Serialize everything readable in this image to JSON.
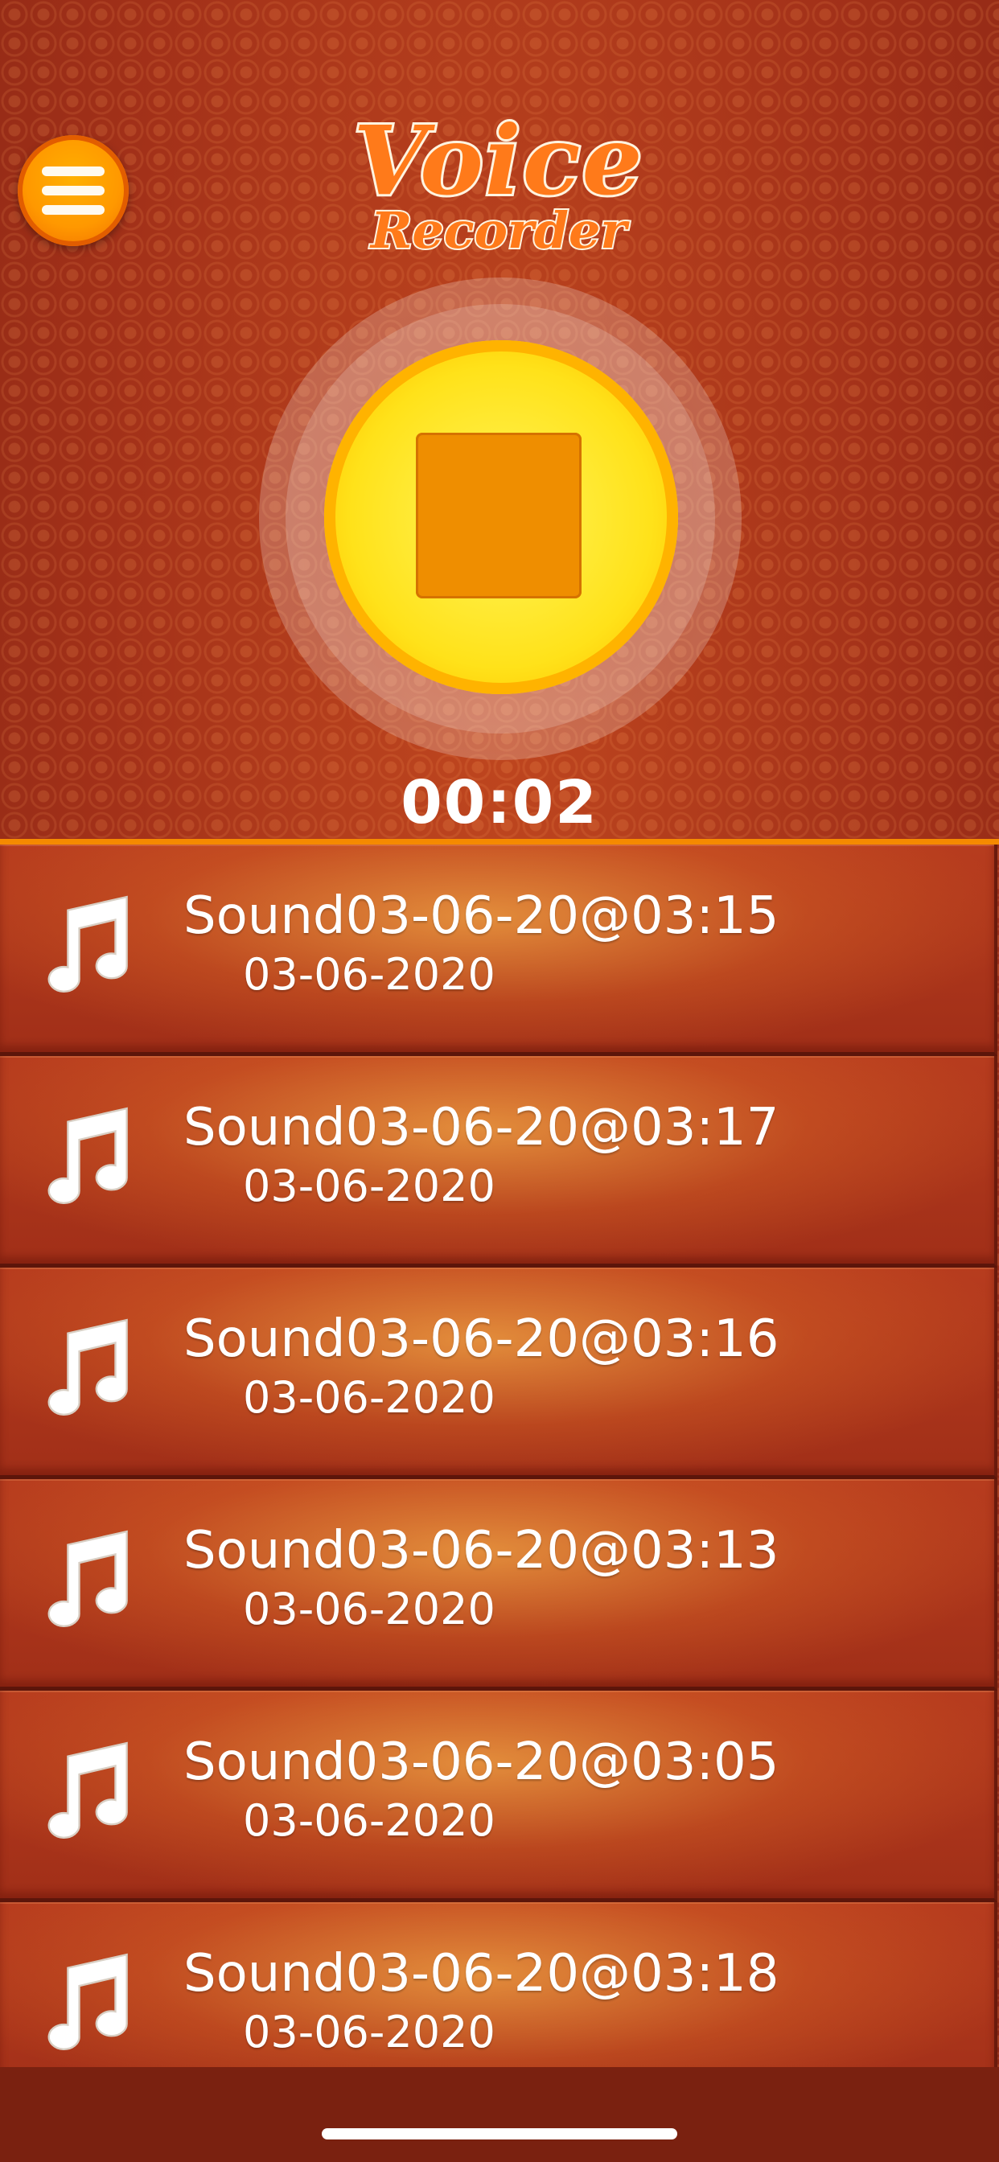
{
  "app": {
    "title_line1": "Voice",
    "title_line2": "Recorder"
  },
  "recorder": {
    "state": "recording",
    "timer": "00:02",
    "button_icon": "stop-icon"
  },
  "menu": {
    "icon": "hamburger-menu-icon"
  },
  "recordings": [
    {
      "name": "Sound03-06-20@03:15",
      "date": "03-06-2020",
      "icon": "music-note-icon"
    },
    {
      "name": "Sound03-06-20@03:17",
      "date": "03-06-2020",
      "icon": "music-note-icon"
    },
    {
      "name": "Sound03-06-20@03:16",
      "date": "03-06-2020",
      "icon": "music-note-icon"
    },
    {
      "name": "Sound03-06-20@03:13",
      "date": "03-06-2020",
      "icon": "music-note-icon"
    },
    {
      "name": "Sound03-06-20@03:05",
      "date": "03-06-2020",
      "icon": "music-note-icon"
    },
    {
      "name": "Sound03-06-20@03:18",
      "date": "03-06-2020",
      "icon": "music-note-icon"
    }
  ],
  "colors": {
    "background": "#a3321d",
    "accent_orange": "#f58a00",
    "record_button": "#ffe21a",
    "stop_square": "#ef8e00"
  }
}
